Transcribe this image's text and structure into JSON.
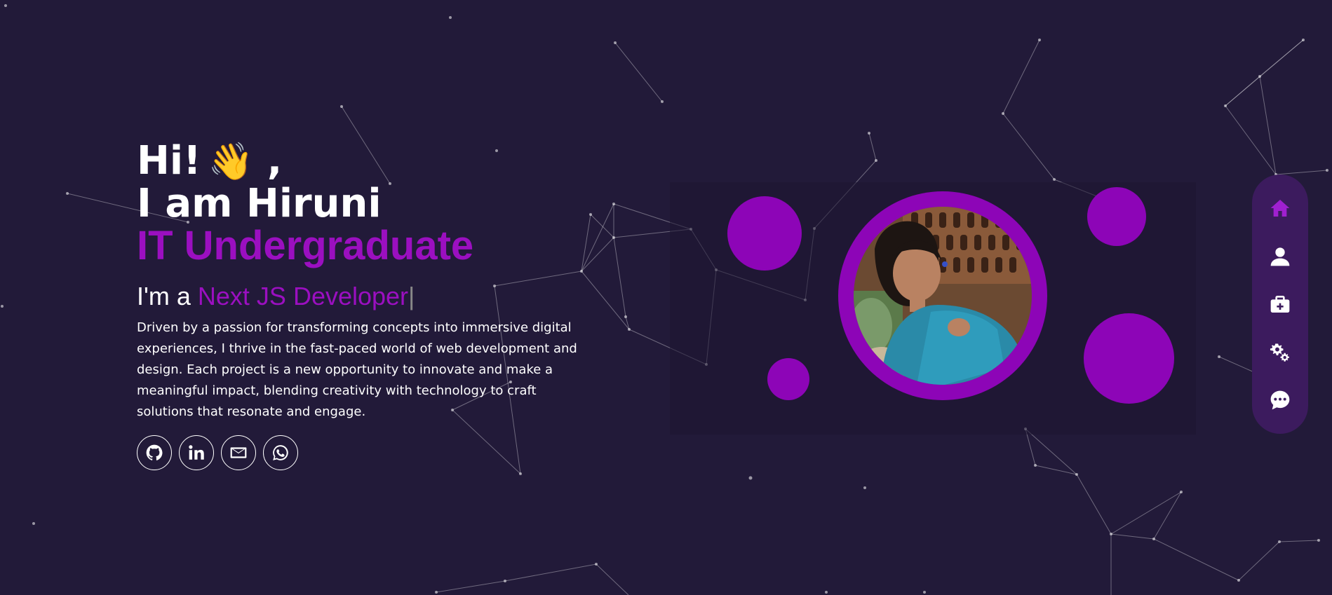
{
  "hero": {
    "greeting": "Hi!",
    "wave_emoji": "👋",
    "greeting_suffix": ",",
    "name_line": "I am Hiruni",
    "role_line": "IT Undergraduate",
    "typing_prefix": "I'm a",
    "typing_role": "Next JS Developer",
    "cursor": "|",
    "description": "Driven by a passion for transforming concepts into immersive digital experiences, I thrive in the fast-paced world of web development and design. Each project is a new opportunity to innovate and make a meaningful impact, blending creativity with technology to craft solutions that resonate and engage."
  },
  "socials": [
    {
      "icon": "github-icon"
    },
    {
      "icon": "linkedin-icon"
    },
    {
      "icon": "mail-icon"
    },
    {
      "icon": "whatsapp-icon"
    }
  ],
  "side_nav": [
    {
      "icon": "home-icon",
      "active": true
    },
    {
      "icon": "user-icon",
      "active": false
    },
    {
      "icon": "briefcase-icon",
      "active": false
    },
    {
      "icon": "gears-icon",
      "active": false
    },
    {
      "icon": "chat-icon",
      "active": false
    }
  ],
  "colors": {
    "background": "#221a39",
    "accent": "#9b0fc0",
    "blob": "#8d05b7",
    "nav_bg": "#3c1b5e"
  }
}
